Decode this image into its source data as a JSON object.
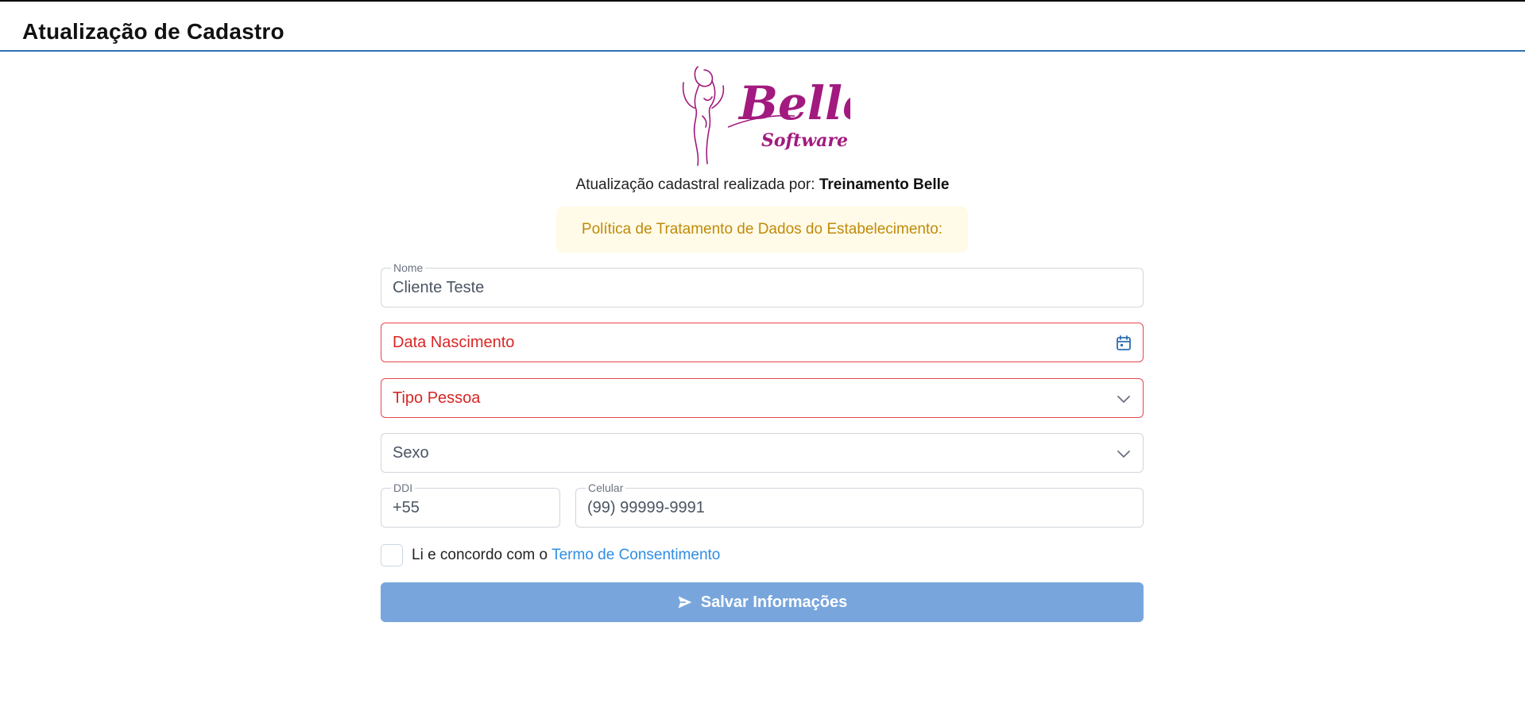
{
  "header": {
    "title": "Atualização de Cadastro"
  },
  "logo": {
    "brand": "Belle",
    "sub": "Software",
    "color": "#a21a7f"
  },
  "author": {
    "prefix": "Atualização cadastral realizada por:",
    "name": "Treinamento Belle"
  },
  "policy": {
    "text": "Política de Tratamento de Dados do Estabelecimento:"
  },
  "form": {
    "nome": {
      "label": "Nome",
      "value": "Cliente Teste"
    },
    "nascimento": {
      "placeholder": "Data Nascimento",
      "icon": "calendar-icon"
    },
    "tipo_pessoa": {
      "placeholder": "Tipo Pessoa",
      "icon": "chevron-down-icon"
    },
    "sexo": {
      "placeholder": "Sexo",
      "icon": "chevron-down-icon"
    },
    "ddi": {
      "label": "DDI",
      "value": "+55"
    },
    "celular": {
      "label": "Celular",
      "value": "(99) 99999-9991"
    },
    "consent": {
      "text": "Li e concordo com o",
      "link": "Termo de Consentimento"
    },
    "save_label": "Salvar Informações"
  },
  "colors": {
    "accent": "#2f6fb3",
    "error": "#e5484d",
    "button": "#78a6dc",
    "warning_bg": "#fffbe8",
    "warning_text": "#c08a0a",
    "link": "#2f8de4"
  }
}
